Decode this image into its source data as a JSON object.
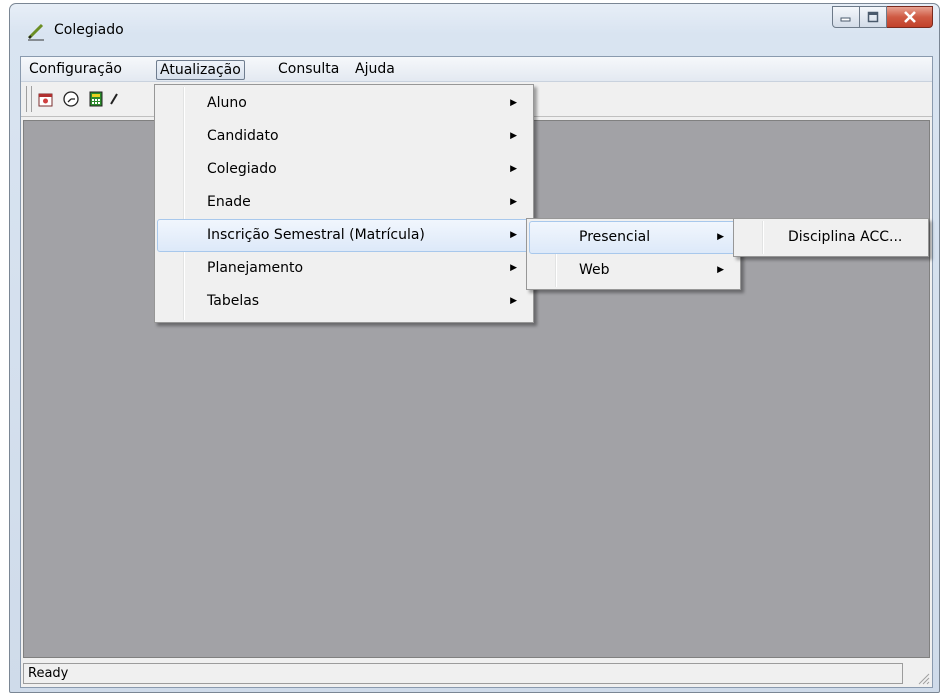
{
  "window": {
    "title": "Colegiado"
  },
  "menubar": [
    "Configuração",
    "Atualização",
    "Consulta",
    "Ajuda"
  ],
  "menu_atualizacao": [
    "Aluno",
    "Candidato",
    "Colegiado",
    "Enade",
    "Inscrição Semestral (Matrícula)",
    "Planejamento",
    "Tabelas"
  ],
  "submenu_inscricao": [
    "Presencial",
    "Web"
  ],
  "submenu_presencial": [
    "Disciplina ACC..."
  ],
  "status": {
    "text": "Ready"
  },
  "icons": {
    "submenu": "▶"
  }
}
